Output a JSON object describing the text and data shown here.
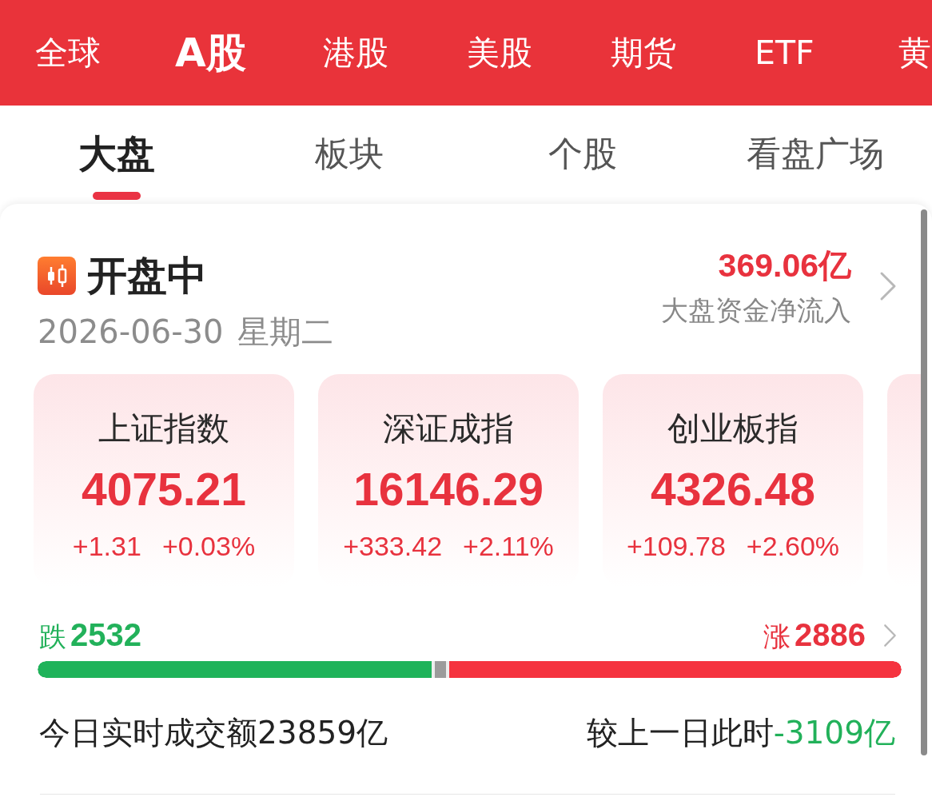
{
  "market_tabs": [
    {
      "label": "全球",
      "selected": false
    },
    {
      "label": "A股",
      "selected": true
    },
    {
      "label": "港股",
      "selected": false
    },
    {
      "label": "美股",
      "selected": false
    },
    {
      "label": "期货",
      "selected": false
    },
    {
      "label": "ETF",
      "selected": false
    },
    {
      "label": "黄",
      "selected": false
    }
  ],
  "section_tabs": [
    {
      "label": "大盘",
      "selected": true
    },
    {
      "label": "板块",
      "selected": false
    },
    {
      "label": "个股",
      "selected": false
    },
    {
      "label": "看盘广场",
      "selected": false
    }
  ],
  "status": {
    "title": "开盘中",
    "date": "2026-06-30",
    "weekday": "星期二",
    "net_inflow": "369.06亿",
    "net_inflow_label": "大盘资金净流入"
  },
  "indices": [
    {
      "kind": "full",
      "name": "上证指数",
      "value": "4075.21",
      "change": "+1.31",
      "change_percent": "+0.03%"
    },
    {
      "kind": "full",
      "name": "深证成指",
      "value": "16146.29",
      "change": "+333.42",
      "change_percent": "+2.11%"
    },
    {
      "kind": "full",
      "name": "创业板指",
      "value": "4326.48",
      "change": "+109.78",
      "change_percent": "+2.60%"
    },
    {
      "kind": "cut"
    }
  ],
  "breadth": {
    "fall_label": "跌",
    "fall_count": "2532",
    "rise_label": "涨",
    "rise_count": "2886",
    "segments": [
      {
        "kind": "fall",
        "level": 0.458
      },
      {
        "kind": "flat",
        "level": 0.017
      },
      {
        "kind": "rise",
        "level": 0.525
      }
    ]
  },
  "turnover": {
    "text": "今日实时成交额23859亿",
    "compare_label": "较上一日此时",
    "compare_value": "-3109亿"
  }
}
